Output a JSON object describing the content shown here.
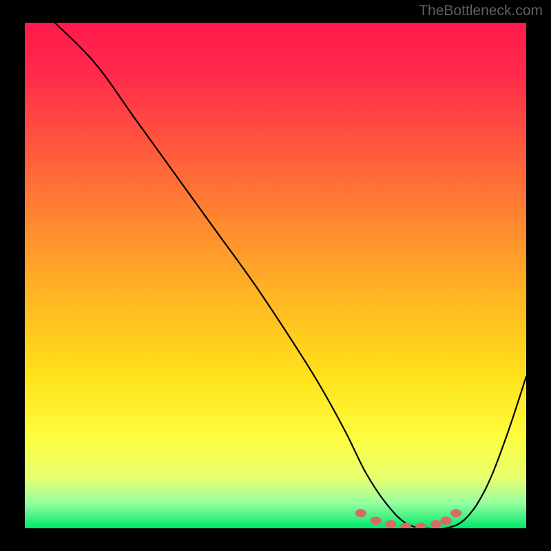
{
  "watermark": "TheBottleneck.com",
  "chart_data": {
    "type": "line",
    "title": "",
    "xlabel": "",
    "ylabel": "",
    "xlim": [
      0,
      100
    ],
    "ylim": [
      0,
      100
    ],
    "series": [
      {
        "name": "bottleneck-curve",
        "x": [
          6,
          14,
          22,
          30,
          38,
          46,
          54,
          59,
          64,
          68,
          72,
          76,
          80,
          84,
          88,
          92,
          96,
          100
        ],
        "values": [
          100,
          92,
          81,
          70,
          59,
          48,
          36,
          28,
          19,
          11,
          5,
          1,
          0,
          0,
          2,
          8,
          18,
          30
        ]
      }
    ],
    "markers": {
      "name": "highlight-dots",
      "x": [
        67,
        70,
        73,
        76,
        79,
        82,
        84,
        86
      ],
      "values": [
        3,
        1.5,
        0.8,
        0.3,
        0.3,
        0.8,
        1.5,
        3
      ]
    },
    "colors": {
      "curve": "#000000",
      "markers": "#d86a66",
      "gradient_top": "#ff1a4d",
      "gradient_bottom": "#00e86b",
      "frame": "#000000"
    }
  }
}
